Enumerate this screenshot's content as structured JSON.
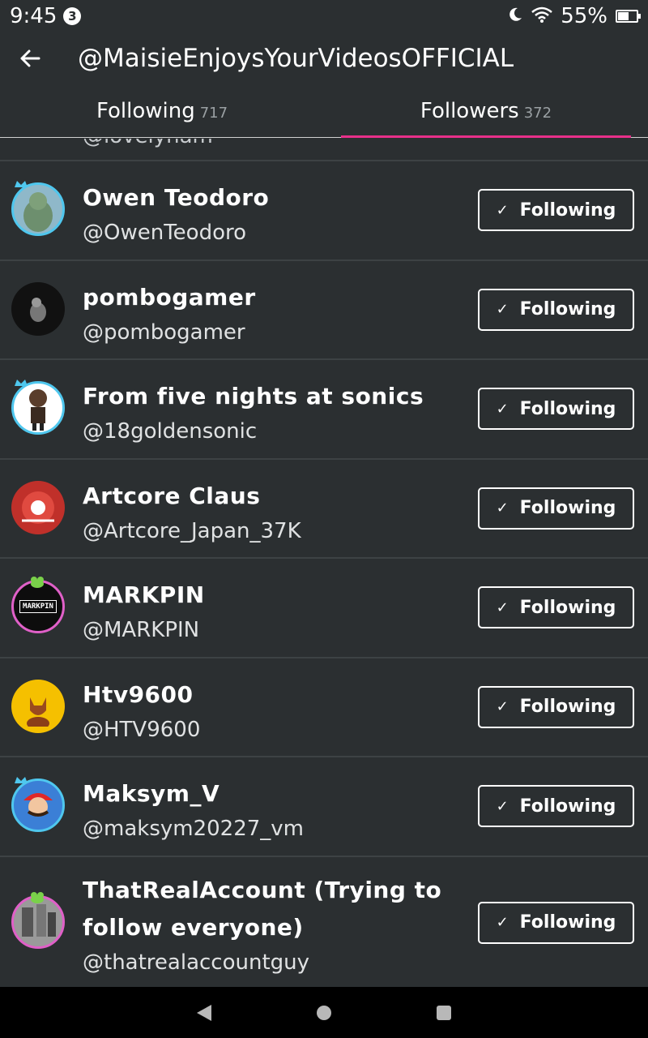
{
  "status_bar": {
    "time": "9:45",
    "notification_count": "3",
    "battery": "55%"
  },
  "header": {
    "title": "@MaisieEnjoysYourVideosOFFICIAL"
  },
  "tabs": [
    {
      "label": "Following",
      "count": "717",
      "active": false
    },
    {
      "label": "Followers",
      "count": "372",
      "active": true
    }
  ],
  "partial_row": {
    "handle": "@lovelyham"
  },
  "button_label": "Following",
  "users": [
    {
      "name": "Owen Teodoro",
      "handle": "@OwenTeodoro"
    },
    {
      "name": "pombogamer",
      "handle": "@pombogamer"
    },
    {
      "name": "From five nights at sonics",
      "handle": "@18goldensonic"
    },
    {
      "name": "Artcore Claus",
      "handle": "@Artcore_Japan_37K"
    },
    {
      "name": "MARKPIN",
      "handle": "@MARKPIN"
    },
    {
      "name": "Htv9600",
      "handle": "@HTV9600"
    },
    {
      "name": "Maksym_V",
      "handle": "@maksym20227_vm"
    },
    {
      "name": "ThatRealAccount (Trying to follow everyone)",
      "handle": "@thatrealaccountguy"
    }
  ],
  "colors": {
    "accent": "#e8308a",
    "background": "#2b2f31",
    "avatar_ring": "#4fc7ee"
  }
}
